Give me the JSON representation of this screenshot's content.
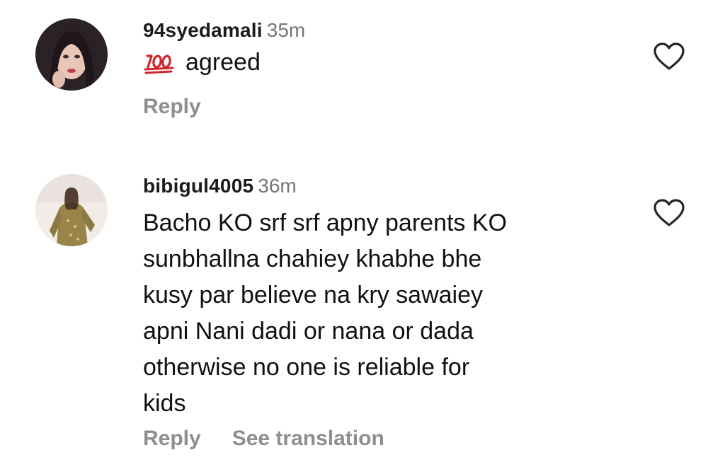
{
  "comments": [
    {
      "username": "94syedamali",
      "time": "35m",
      "emoji_icon": "hundred-points-emoji",
      "text": "agreed",
      "reply_label": "Reply"
    },
    {
      "username": "bibigul4005",
      "time": "36m",
      "text_lines": [
        "Bacho KO srf srf apny parents KO",
        "sunbhallna chahiey khabhe bhe",
        "kusy par believe na kry sawaiey",
        "apni Nani dadi or nana or dada",
        "otherwise no one is reliable for",
        "kids"
      ],
      "reply_label": "Reply",
      "translation_label": "See translation"
    }
  ],
  "colors": {
    "username": "#1b1b1b",
    "timestamp": "#767676",
    "action_text": "#8e8e8e",
    "emoji_red": "#d0252a"
  }
}
